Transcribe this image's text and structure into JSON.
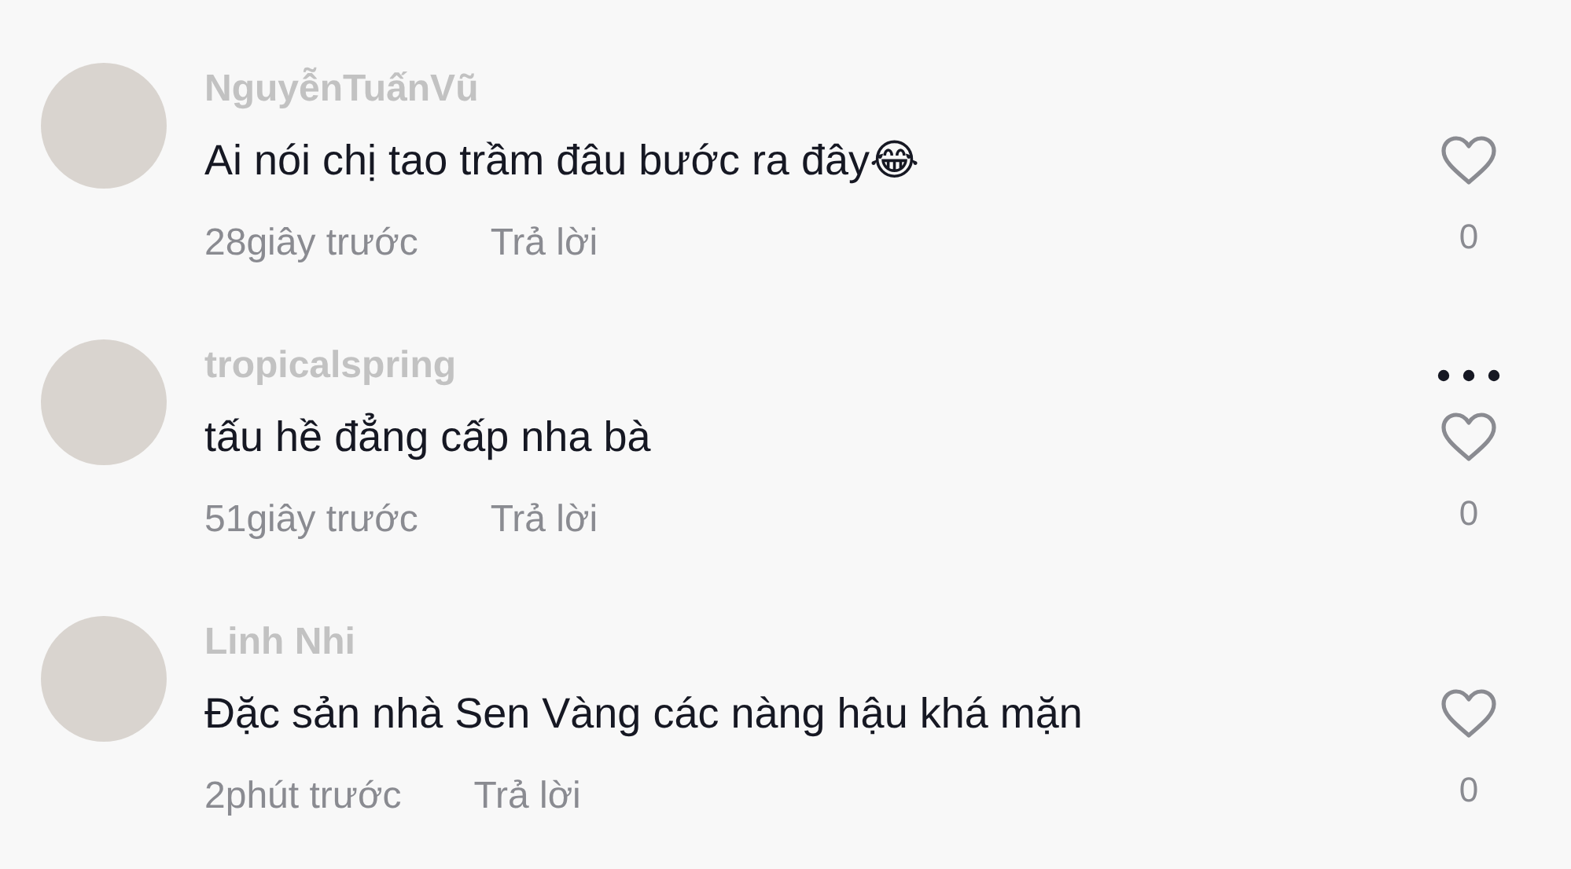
{
  "comments": [
    {
      "username": "NguyễnTuấnVũ",
      "text": "Ai nói chị tao trầm đâu bước ra đây😂",
      "time": "28giây trước",
      "reply": "Trả lời",
      "menu_visible": false,
      "liked": false,
      "likes": "0"
    },
    {
      "username": "tropicalspring",
      "text": "tấu hề đẳng cấp nha bà",
      "time": "51giây trước",
      "reply": "Trả lời",
      "menu_visible": true,
      "liked": false,
      "likes": "0"
    },
    {
      "username": "Linh Nhi",
      "text": "Đặc sản nhà Sen Vàng các nàng hậu khá mặn",
      "time": "2phút trước",
      "reply": "Trả lời",
      "menu_visible": false,
      "liked": false,
      "likes": "0"
    }
  ]
}
